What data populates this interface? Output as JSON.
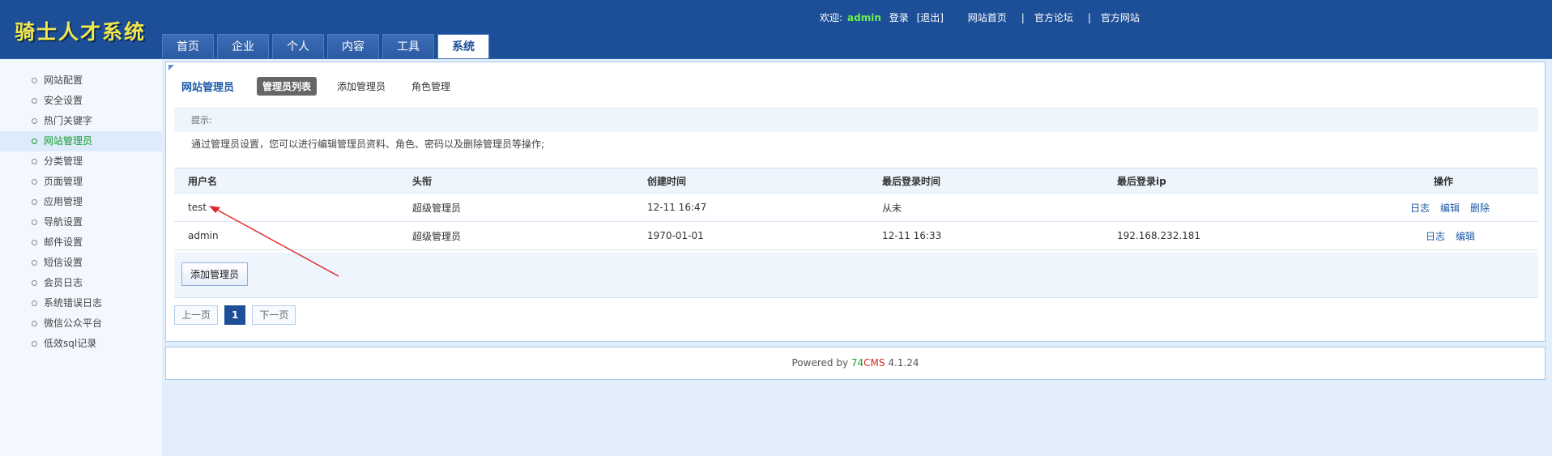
{
  "header": {
    "logo": "骑士人才系统",
    "welcome_label": "欢迎:",
    "username": "admin",
    "login_label": "登录",
    "logout_label": "[退出]",
    "links": [
      "网站首页",
      "官方论坛",
      "官方网站"
    ],
    "tabs": [
      "首页",
      "企业",
      "个人",
      "内容",
      "工具",
      "系统"
    ],
    "active_tab": "系统"
  },
  "sidebar": {
    "items": [
      "网站配置",
      "安全设置",
      "热门关键字",
      "网站管理员",
      "分类管理",
      "页面管理",
      "应用管理",
      "导航设置",
      "邮件设置",
      "短信设置",
      "会员日志",
      "系统错误日志",
      "微信公众平台",
      "低效sql记录"
    ],
    "active": "网站管理员"
  },
  "main": {
    "title": "网站管理员",
    "subtabs": [
      "管理员列表",
      "添加管理员",
      "角色管理"
    ],
    "tip_label": "提示:",
    "tip_text": "通过管理员设置，您可以进行编辑管理员资料、角色、密码以及删除管理员等操作;",
    "columns": [
      "用户名",
      "头衔",
      "创建时间",
      "最后登录时间",
      "最后登录ip",
      "操作"
    ],
    "rows": [
      {
        "username": "test",
        "title": "超级管理员",
        "created": "12-11 16:47",
        "last_login": "从未",
        "ip": "",
        "actions": [
          "日志",
          "编辑",
          "删除"
        ]
      },
      {
        "username": "admin",
        "title": "超级管理员",
        "created": "1970-01-01",
        "last_login": "12-11 16:33",
        "ip": "192.168.232.181",
        "actions": [
          "日志",
          "编辑"
        ]
      }
    ],
    "add_button": "添加管理员",
    "pager": {
      "prev": "上一页",
      "current": "1",
      "next": "下一页"
    }
  },
  "footer": {
    "prefix": "Powered by ",
    "brand_a": "74",
    "brand_b": "CMS",
    "version": " 4.1.24"
  },
  "colors": {
    "header": "#1c4f98",
    "active_green": "#199c31",
    "link_blue": "#1c5ba6",
    "annotation_arrow": "#e0262a"
  }
}
